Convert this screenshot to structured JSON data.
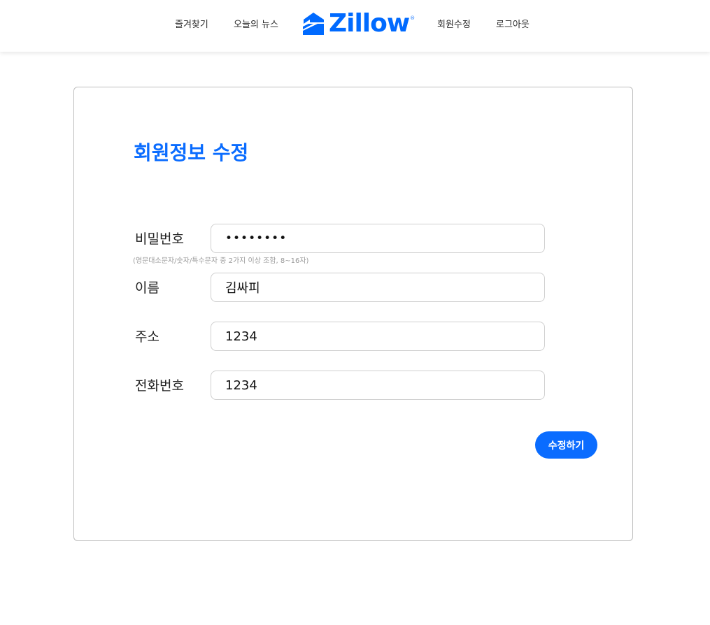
{
  "header": {
    "nav_left": [
      "즐겨찾기",
      "오늘의 뉴스"
    ],
    "logo_text": "Zillow",
    "logo_reg": "®",
    "nav_right": [
      "회원수정",
      "로그아웃"
    ]
  },
  "form": {
    "title": "회원정보 수정",
    "password": {
      "label": "비밀번호",
      "value": "••••••••",
      "hint": "(영문대소문자/숫자/특수문자 중 2가지 이상 조합, 8~16자)"
    },
    "name": {
      "label": "이름",
      "value": "김싸피"
    },
    "address": {
      "label": "주소",
      "value": "1234"
    },
    "phone": {
      "label": "전화번호",
      "value": "1234"
    },
    "submit_label": "수정하기"
  },
  "colors": {
    "brand": "#006aff",
    "title": "#0a6cff",
    "button": "#0a6cff"
  },
  "icons": {
    "logo": "zillow-house-icon"
  }
}
